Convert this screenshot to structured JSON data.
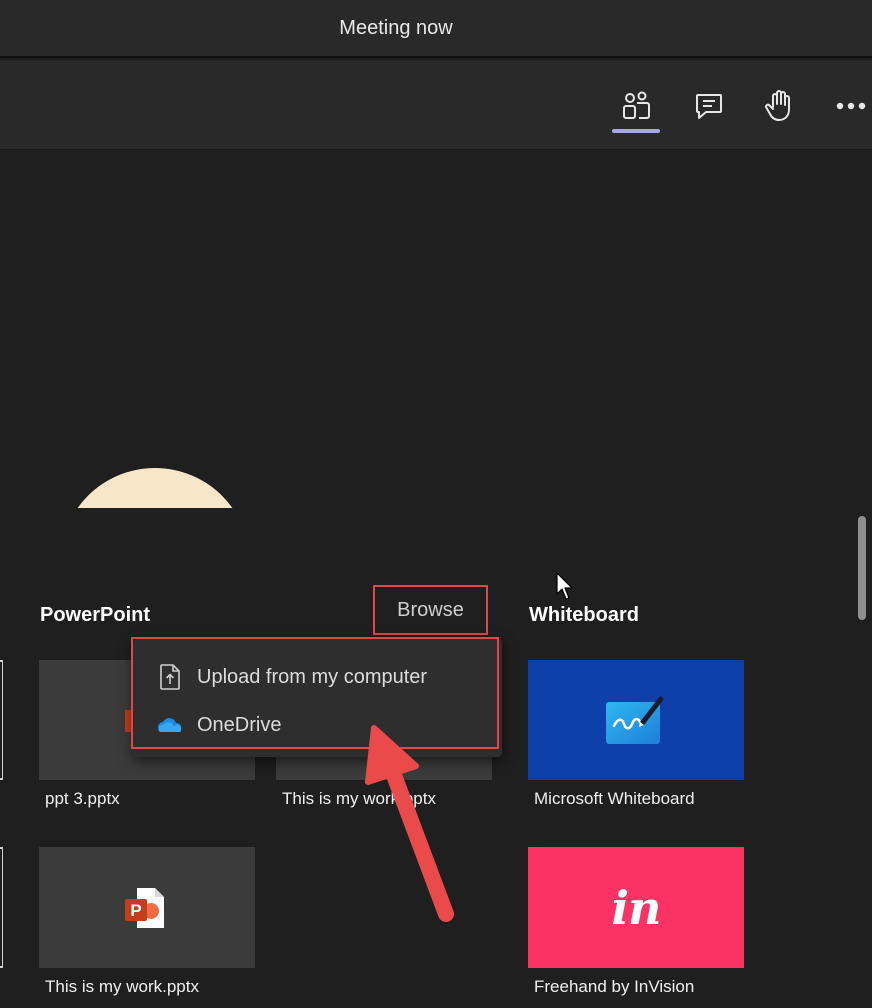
{
  "titlebar": {
    "title": "Meeting now"
  },
  "toolbar": {
    "buttons": [
      {
        "name": "people-button",
        "icon": "people-icon",
        "active": true
      },
      {
        "name": "chat-button",
        "icon": "chat-icon"
      },
      {
        "name": "raise-hand-button",
        "icon": "hand-icon"
      },
      {
        "name": "more-actions-button",
        "icon": "more-icon"
      }
    ]
  },
  "share_tray": {
    "powerpoint": {
      "title": "PowerPoint",
      "browse_label": "Browse",
      "files": [
        {
          "label": "ppt 3.pptx"
        },
        {
          "label": "This is my work.pptx"
        },
        {
          "label": "This is my work.pptx"
        }
      ]
    },
    "whiteboard": {
      "title": "Whiteboard",
      "apps": [
        {
          "label": "Microsoft Whiteboard",
          "icon": "whiteboard-icon"
        },
        {
          "label": "Freehand by InVision",
          "icon": "invision-logo",
          "logo_text": "in"
        }
      ]
    },
    "browse_menu": {
      "items": [
        {
          "label": "Upload from my computer",
          "icon": "upload-file-icon"
        },
        {
          "label": "OneDrive",
          "icon": "onedrive-icon"
        }
      ]
    }
  },
  "colors": {
    "accent_underline": "#a7a8e8",
    "annotation_red": "#e04848",
    "whiteboard_bg": "#0d40a8",
    "invision_bg": "#fb3364",
    "powerpoint_orange": "#c43e1c"
  }
}
